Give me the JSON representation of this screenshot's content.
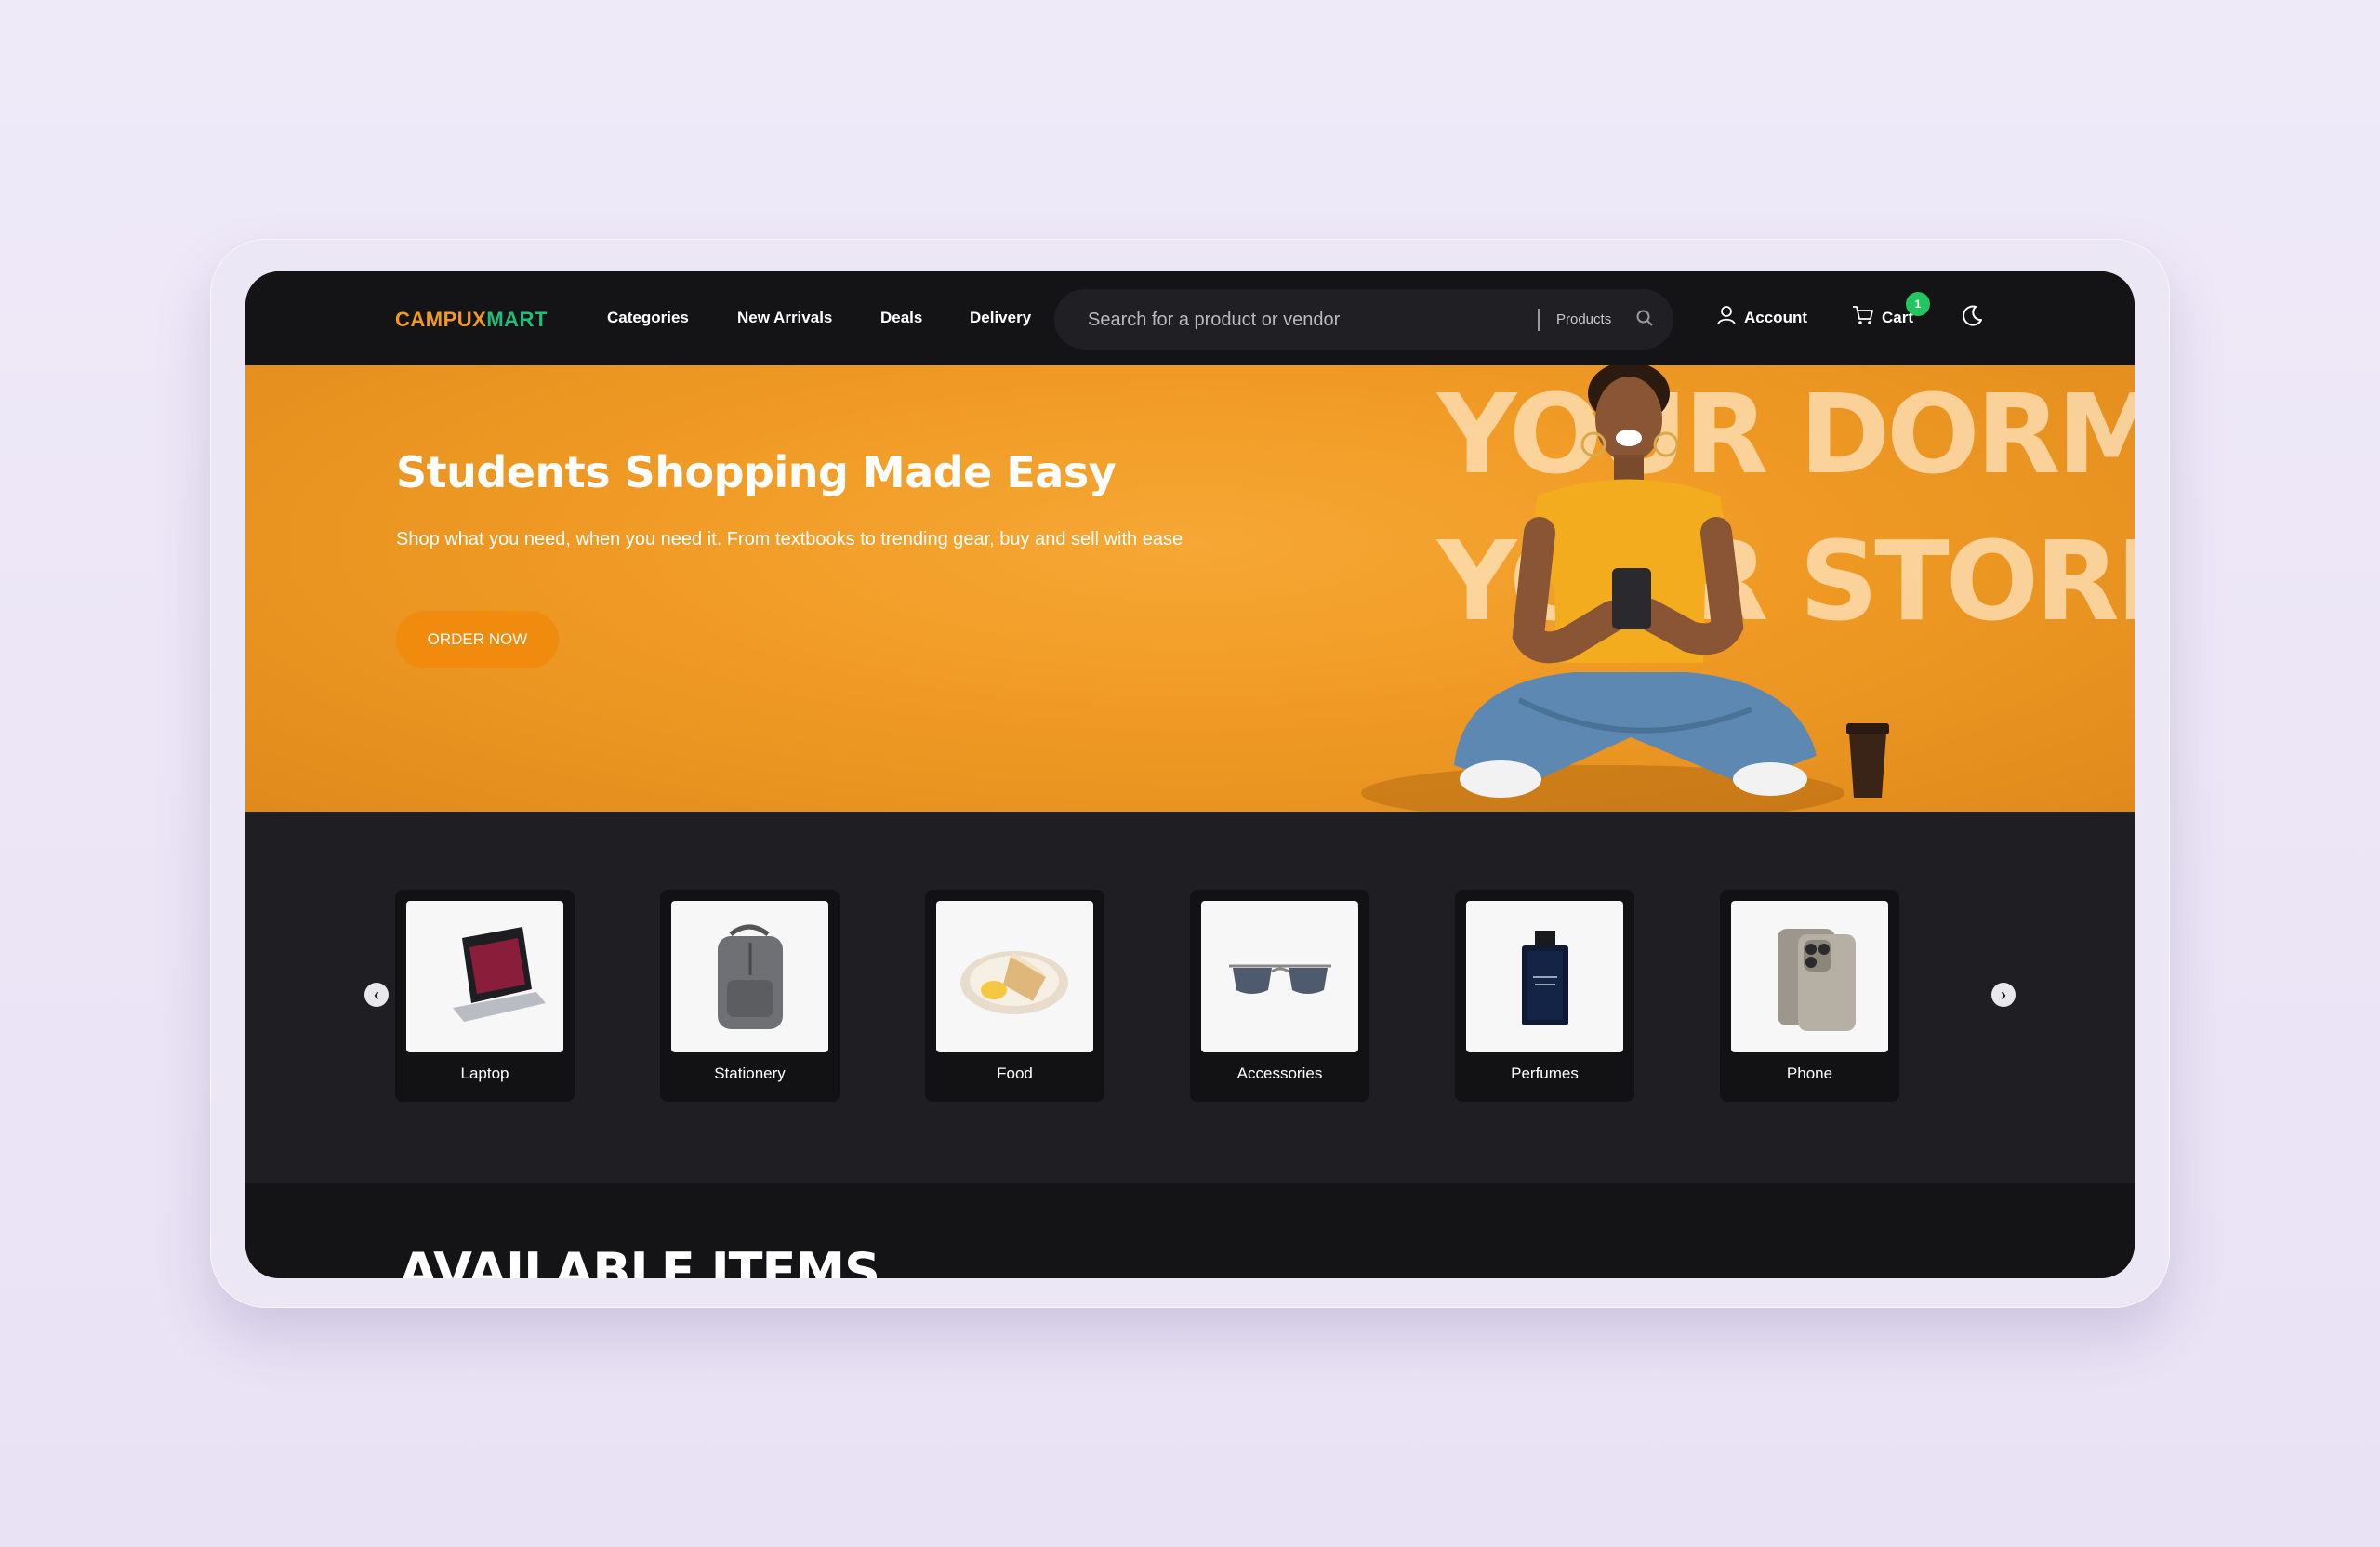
{
  "brand": {
    "part1": "CAMPUX",
    "part2": "MART",
    "color1": "#f39a1c",
    "color2": "#1fbf7a"
  },
  "nav": {
    "links": [
      "Categories",
      "New Arrivals",
      "Deals",
      "Delivery"
    ],
    "search_placeholder": "Search for a product or vendor",
    "search_filter": "Products",
    "account": "Account",
    "cart": "Cart",
    "cart_count": "1"
  },
  "hero": {
    "title": "Students Shopping Made Easy",
    "subtitle": "Shop what you need, when you need it. From textbooks to trending gear, buy and sell with ease",
    "cta": "ORDER NOW",
    "overlay_line1": "YOUR DORM",
    "overlay_line2": "YOUR STORE",
    "accent": "#f09a25"
  },
  "categories": [
    {
      "label": "Laptop",
      "icon": "laptop-icon"
    },
    {
      "label": "Stationery",
      "icon": "backpack-icon"
    },
    {
      "label": "Food",
      "icon": "cake-plate-icon"
    },
    {
      "label": "Accessories",
      "icon": "sunglasses-icon"
    },
    {
      "label": "Perfumes",
      "icon": "perfume-bottle-icon"
    },
    {
      "label": "Phone",
      "icon": "phone-icon"
    }
  ],
  "section_heading": "AVAILABLE ITEMS"
}
